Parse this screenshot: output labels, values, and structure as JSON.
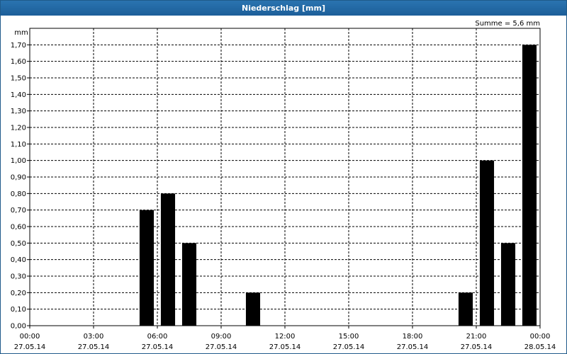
{
  "window": {
    "title": "Niederschlag [mm]"
  },
  "chart_data": {
    "type": "bar",
    "title": "Niederschlag [mm]",
    "ylabel": "mm",
    "annotation": "Summe = 5,6 mm",
    "ylim": [
      0,
      1.8
    ],
    "yticks": [
      "0,00",
      "0,10",
      "0,20",
      "0,30",
      "0,40",
      "0,50",
      "0,60",
      "0,70",
      "0,80",
      "0,90",
      "1,00",
      "1,10",
      "1,20",
      "1,30",
      "1,40",
      "1,50",
      "1,60",
      "1,70"
    ],
    "xlim_hours": [
      0,
      24
    ],
    "xticks": [
      {
        "time": "00:00",
        "date": "27.05.14"
      },
      {
        "time": "03:00",
        "date": "27.05.14"
      },
      {
        "time": "06:00",
        "date": "27.05.14"
      },
      {
        "time": "09:00",
        "date": "27.05.14"
      },
      {
        "time": "12:00",
        "date": "27.05.14"
      },
      {
        "time": "15:00",
        "date": "27.05.14"
      },
      {
        "time": "18:00",
        "date": "27.05.14"
      },
      {
        "time": "21:00",
        "date": "27.05.14"
      },
      {
        "time": "00:00",
        "date": "28.05.14"
      }
    ],
    "bars": [
      {
        "hour": 5.5,
        "value": 0.7
      },
      {
        "hour": 6.5,
        "value": 0.8
      },
      {
        "hour": 7.5,
        "value": 0.5
      },
      {
        "hour": 10.5,
        "value": 0.2
      },
      {
        "hour": 20.5,
        "value": 0.2
      },
      {
        "hour": 21.5,
        "value": 1.0
      },
      {
        "hour": 22.5,
        "value": 0.5
      },
      {
        "hour": 23.5,
        "value": 1.7
      }
    ],
    "grid": true,
    "bar_color": "#000000"
  }
}
